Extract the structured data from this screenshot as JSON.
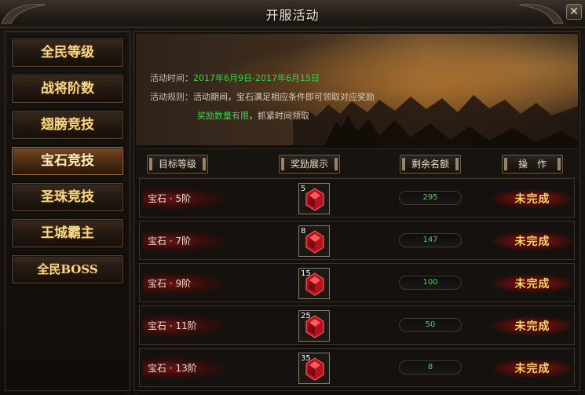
{
  "window": {
    "title": "开服活动",
    "close_label": "✕"
  },
  "sidebar": {
    "items": [
      {
        "label": "全民等级",
        "active": false
      },
      {
        "label": "战将阶数",
        "active": false
      },
      {
        "label": "翅膀竞技",
        "active": false
      },
      {
        "label": "宝石竞技",
        "active": true
      },
      {
        "label": "圣珠竞技",
        "active": false
      },
      {
        "label": "王城霸主",
        "active": false
      },
      {
        "label": "全民BOSS",
        "active": false
      }
    ]
  },
  "banner": {
    "time_label": "活动时间：",
    "time_value": "2017年6月9日-2017年6月15日",
    "rule_label": "活动规则：",
    "rule_text": "活动期间，宝石满足相应条件即可领取对应奖励",
    "notice_green": "奖励数量有限",
    "notice_text": "，抓紧时间领取"
  },
  "table": {
    "headers": [
      "目标等级",
      "奖励展示",
      "剩余名额",
      "操　作"
    ],
    "rows": [
      {
        "target": "宝石 · 5阶",
        "reward_count": "5",
        "reward_icon": "red-gem-icon",
        "remaining": "295",
        "status": "未完成"
      },
      {
        "target": "宝石 · 7阶",
        "reward_count": "8",
        "reward_icon": "red-gem-icon",
        "remaining": "147",
        "status": "未完成"
      },
      {
        "target": "宝石 · 9阶",
        "reward_count": "15",
        "reward_icon": "red-gem-icon",
        "remaining": "100",
        "status": "未完成"
      },
      {
        "target": "宝石 · 11阶",
        "reward_count": "25",
        "reward_icon": "red-gem-icon",
        "remaining": "50",
        "status": "未完成"
      },
      {
        "target": "宝石 · 13阶",
        "reward_count": "35",
        "reward_icon": "red-gem-icon",
        "remaining": "8",
        "status": "未完成"
      }
    ]
  },
  "colors": {
    "accent_gold": "#f4d98a",
    "green_text": "#35d64a",
    "status_red": "#8c1414"
  }
}
